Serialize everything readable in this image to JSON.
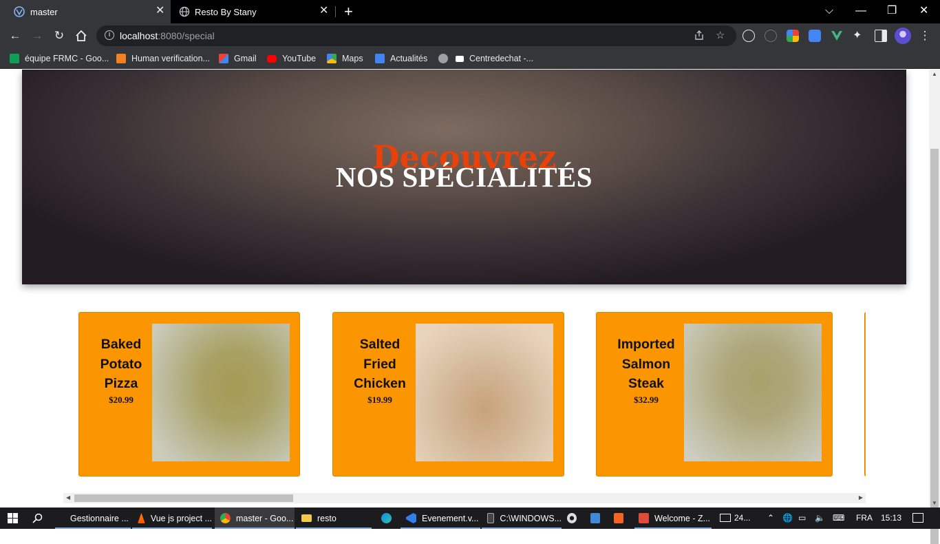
{
  "browser": {
    "tabs": [
      {
        "title": "master",
        "active": true,
        "icon": "vue-devtools-icon"
      },
      {
        "title": "Resto By Stany",
        "active": false,
        "icon": "globe-icon"
      }
    ],
    "new_tab": "+",
    "close_glyph": "✕",
    "window_controls": {
      "menu": "⌵",
      "minimize": "—",
      "restore": "❐",
      "close": "✕"
    },
    "address": {
      "host": "localhost",
      "rest": ":8080/special"
    },
    "bookmarks": [
      {
        "label": "équipe FRMC - Goo...",
        "color": "#0f9d58"
      },
      {
        "label": "Human verification...",
        "color": "#f48024"
      },
      {
        "label": "Gmail",
        "color": "#ea4335"
      },
      {
        "label": "YouTube",
        "color": "#ff0000"
      },
      {
        "label": "Maps",
        "color": "#34a853"
      },
      {
        "label": "Actualités",
        "color": "#4285f4"
      },
      {
        "label": "",
        "color": "#9aa0a6"
      },
      {
        "label": "Centredechat -...",
        "color": "#ffffff"
      }
    ]
  },
  "hero": {
    "script": "Decouvrez",
    "title": "NOS SPÉCIALITÉS"
  },
  "cards": [
    {
      "name_lines": [
        "Baked",
        "Potato",
        "Pizza"
      ],
      "price": "$20.99",
      "photo_tone": "olive"
    },
    {
      "name_lines": [
        "Salted",
        "Fried",
        "Chicken"
      ],
      "price": "$19.99",
      "photo_tone": "tan"
    },
    {
      "name_lines": [
        "Imported",
        "Salmon",
        "Steak"
      ],
      "price": "$32.99",
      "photo_tone": "olive"
    }
  ],
  "taskbar": {
    "items": [
      {
        "label": "Gestionnaire ...",
        "color": "#f0c040"
      },
      {
        "label": "Vue js project ...",
        "color": "#ff8800"
      },
      {
        "label": "master - Goo...",
        "color": "#4285f4"
      },
      {
        "label": "resto",
        "color": "#f2c94c"
      },
      {
        "label": "",
        "color": "#0c8ce9"
      },
      {
        "label": "Evenement.v...",
        "color": "#2f80ed"
      },
      {
        "label": "C:\\WINDOWS...",
        "color": "#444444"
      },
      {
        "label": "",
        "color": "#dddddd"
      },
      {
        "label": "",
        "color": "#3f8bd6"
      },
      {
        "label": "",
        "color": "#f26522"
      },
      {
        "label": "Welcome - Z...",
        "color": "#e04a3a"
      }
    ],
    "tray": {
      "news": "24...",
      "lang": "FRA",
      "time": "15:13"
    }
  },
  "colors": {
    "accent_orange": "#fb9601",
    "hero_script": "#e9410a"
  }
}
